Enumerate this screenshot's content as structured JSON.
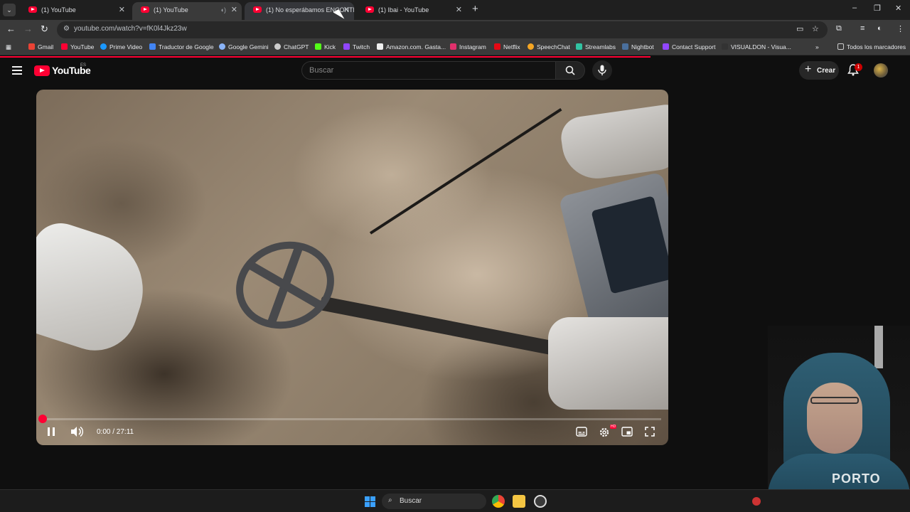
{
  "browser": {
    "tabs": [
      {
        "label": "(1) YouTube",
        "active": false
      },
      {
        "label": "(1) YouTube",
        "active": true
      },
      {
        "label": "(1) No esperábamos ENCONTR",
        "active": false
      },
      {
        "label": "(1) Ibai - YouTube",
        "active": false
      }
    ],
    "url": "youtube.com/watch?v=fK0l4Jkz23w",
    "bookmarks": [
      "Gmail",
      "YouTube",
      "Prime Video",
      "Traductor de Google",
      "Google Gemini",
      "ChatGPT",
      "Kick",
      "Twitch",
      "Amazon.com. Gasta...",
      "Instagram",
      "Netflix",
      "SpeechChat",
      "Streamlabs",
      "Nightbot",
      "Contact Support",
      "VISUALDON - Visua..."
    ],
    "all_bookmarks": "Todos los marcadores"
  },
  "youtube": {
    "logo": "YouTube",
    "country": "ES",
    "search_placeholder": "Buscar",
    "create_label": "Crear",
    "notifications": "1"
  },
  "player": {
    "time": "0:00 / 27:11",
    "progress": 0.0
  },
  "taskbar": {
    "search_label": "Buscar"
  },
  "webcam": {
    "shirt_text": "PORTO"
  },
  "colors": {
    "accent": "#ff0033",
    "background": "#0f0f0f"
  }
}
